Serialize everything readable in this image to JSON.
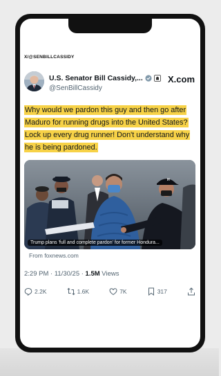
{
  "source_tag": "X/@SENBILLCASSIDY",
  "post": {
    "author_name": "U.S. Senator Bill Cassidy,...",
    "handle": "@SenBillCassidy",
    "site_logo": "X.com",
    "text": "Why would we pardon this guy and then go after Maduro for running drugs into the United States? Lock up every drug runner! Don't understand why he is being pardoned.",
    "highlight_color": "#f7d247",
    "media_caption": "Trump plans 'full and complete pardon' for former Hondura...",
    "link_source": "From foxnews.com",
    "timestamp": "2:29 PM · 11/30/25 · ",
    "views_count": "1.5M",
    "views_label": " Views"
  },
  "actions": {
    "replies": "2.2K",
    "reposts": "1.6K",
    "likes": "7K",
    "bookmarks": "317"
  },
  "icons": [
    "verified-badge-icon",
    "affiliation-badge-icon",
    "reply-icon",
    "repost-icon",
    "like-icon",
    "bookmark-icon",
    "share-icon"
  ]
}
